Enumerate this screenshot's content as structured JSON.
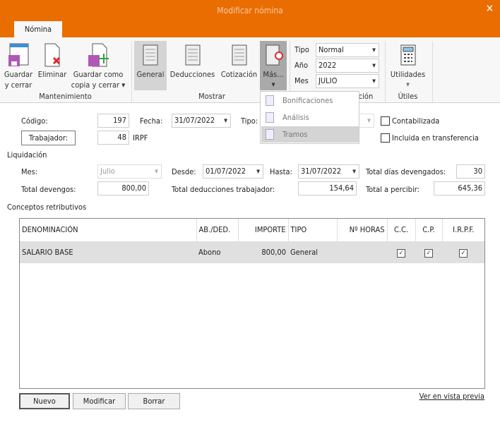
{
  "window": {
    "title": "Modificar nómina",
    "close_icon": "close-icon"
  },
  "ribbon": {
    "tab": "Nómina",
    "buttons": {
      "guardar_cerrar": [
        "Guardar",
        "y cerrar"
      ],
      "eliminar": "Eliminar",
      "guardar_copia": [
        "Guardar como",
        "copia y cerrar ▾"
      ],
      "general": "General",
      "deducciones": "Deducciones",
      "cotizacion": "Cotización",
      "mas": "Más...",
      "utilidades": "Utilidades"
    },
    "groups": {
      "mantenimiento": "Mantenimiento",
      "mostrar": "Mostrar",
      "liquidacion": "Liquidación",
      "utiles": "Útiles"
    },
    "tipo": {
      "label": "Tipo",
      "value": "Normal"
    },
    "anio": {
      "label": "Año",
      "value": "2022"
    },
    "mes": {
      "label": "Mes",
      "value": "JULIO"
    },
    "mas_menu": [
      "Bonificaciones",
      "Análisis",
      "Tramos"
    ]
  },
  "form": {
    "codigo": {
      "label": "Código:",
      "value": "197"
    },
    "fecha": {
      "label": "Fecha:",
      "value": "31/07/2022"
    },
    "tipo": {
      "label": "Tipo:"
    },
    "contabilizada": {
      "label": "Contabilizada",
      "checked": false
    },
    "trabajador": {
      "label": "Trabajador:",
      "value": "48",
      "suffix": "IRPF"
    },
    "incluida": {
      "label": "Incluida en transferencia",
      "checked": false
    }
  },
  "liquidacion": {
    "title": "Liquidación",
    "mes": {
      "label": "Mes:",
      "value": "Julio"
    },
    "desde": {
      "label": "Desde:",
      "value": "01/07/2022"
    },
    "hasta": {
      "label": "Hasta:",
      "value": "31/07/2022"
    },
    "dias": {
      "label": "Total días devengados:",
      "value": "30"
    },
    "devengos": {
      "label": "Total devengos:",
      "value": "800,00"
    },
    "deducciones": {
      "label": "Total deducciones trabajador:",
      "value": "154,64"
    },
    "percibir": {
      "label": "Total a percibir:",
      "value": "645,36"
    }
  },
  "conceptos": {
    "title": "Conceptos retributivos",
    "columns": [
      "DENOMINACIÓN",
      "AB./DED.",
      "IMPORTE",
      "TIPO",
      "Nº HORAS",
      "C.C.",
      "C.P.",
      "I.R.P.F."
    ],
    "rows": [
      {
        "denominacion": "SALARIO BASE",
        "abded": "Abono",
        "importe": "800,00",
        "tipo": "General",
        "horas": "",
        "cc": true,
        "cp": true,
        "irpf": true
      }
    ]
  },
  "footer": {
    "nuevo": "Nuevo",
    "modificar": "Modificar",
    "borrar": "Borrar",
    "preview": "Ver en vista previa"
  }
}
